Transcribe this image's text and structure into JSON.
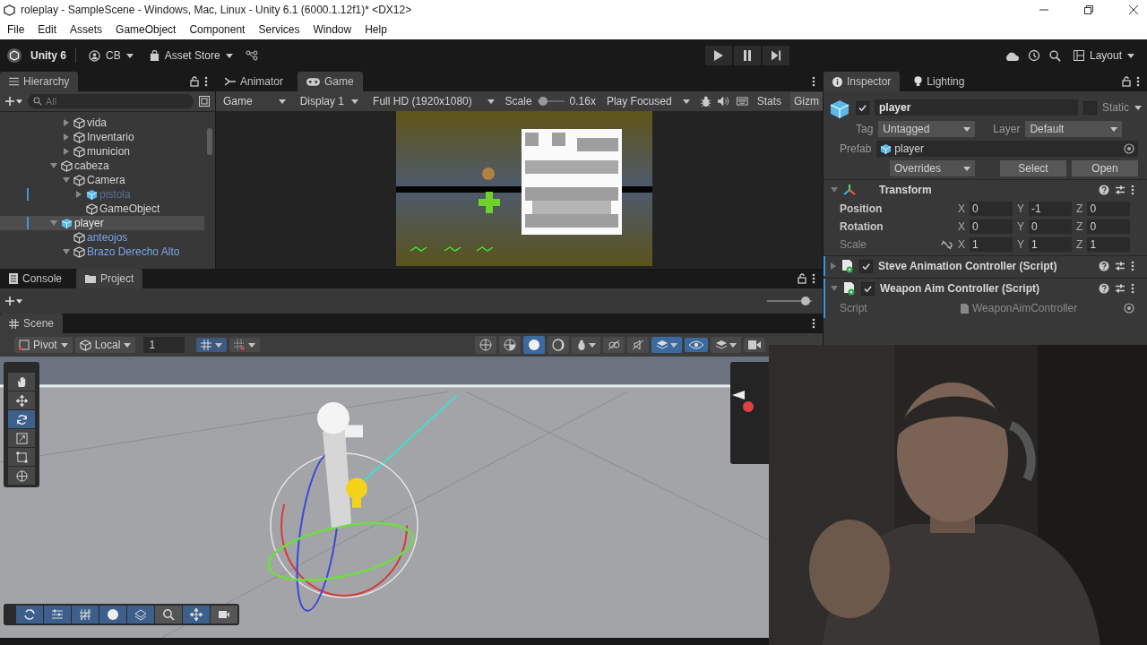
{
  "window": {
    "title": "roleplay - SampleScene - Windows, Mac, Linux - Unity 6.1 (6000.1.12f1)* <DX12>"
  },
  "menu": [
    "File",
    "Edit",
    "Assets",
    "GameObject",
    "Component",
    "Services",
    "Window",
    "Help"
  ],
  "toolbar": {
    "product": "Unity 6",
    "account": "CB",
    "store": "Asset Store",
    "layout": "Layout"
  },
  "hierarchy": {
    "title": "Hierarchy",
    "search_placeholder": "All",
    "items": [
      {
        "children": [
          {
            "name": "vida",
            "expanded": false,
            "selected": false,
            "disabled": false,
            "prefab": false,
            "prefab_root": false,
            "override": false
          },
          {
            "name": "Inventario",
            "expanded": false,
            "selected": false,
            "disabled": false,
            "prefab": false,
            "prefab_root": false,
            "override": false
          },
          {
            "name": "municion",
            "expanded": false,
            "selected": false,
            "disabled": false,
            "prefab": false,
            "prefab_root": false,
            "override": false
          }
        ]
      },
      {
        "name": "cabeza",
        "expanded": true,
        "selected": false,
        "disabled": false,
        "prefab": false,
        "prefab_root": false,
        "override": false,
        "children": [
          {
            "name": "Camera",
            "expanded": true,
            "selected": false,
            "disabled": false,
            "prefab": false,
            "prefab_root": false,
            "override": false,
            "children": [
              {
                "name": "pistola",
                "expanded": false,
                "selected": false,
                "disabled": true,
                "prefab": true,
                "prefab_root": true,
                "override": true
              },
              {
                "name": "GameObject",
                "selected": false,
                "disabled": false,
                "prefab": false,
                "prefab_root": false,
                "override": false
              }
            ]
          }
        ]
      },
      {
        "name": "player",
        "expanded": true,
        "selected": true,
        "disabled": false,
        "prefab": false,
        "prefab_root": true,
        "override": true,
        "children": [
          {
            "name": "anteojos",
            "selected": false,
            "disabled": false,
            "prefab": true,
            "prefab_root": false,
            "override": false
          },
          {
            "name": "Brazo Derecho Alto",
            "expanded": true,
            "selected": false,
            "disabled": false,
            "prefab": true,
            "prefab_root": false,
            "override": false
          }
        ]
      }
    ]
  },
  "game": {
    "tabs": [
      {
        "label": "Animator",
        "selected": false
      },
      {
        "label": "Game",
        "selected": true
      }
    ],
    "view": "Game",
    "display": "Display 1",
    "resolution": "Full HD (1920x1080)",
    "scale_label": "Scale",
    "scale_slider": {
      "level": 0.05
    },
    "scale": "0.16x",
    "play_mode": "Play Focused",
    "stats": "Stats",
    "gizmos": "Gizm"
  },
  "inspector": {
    "tabs": [
      {
        "label": "Inspector",
        "selected": true
      },
      {
        "label": "Lighting",
        "selected": false
      }
    ],
    "object": {
      "name": "player",
      "active": true,
      "static": false,
      "static_label": "Static",
      "tag_label": "Tag",
      "tag": "Untagged",
      "layer_label": "Layer",
      "layer": "Default",
      "prefab_label": "Prefab",
      "prefab": "player",
      "overrides": "Overrides",
      "select": "Select",
      "open": "Open"
    },
    "components": [
      {
        "kind": "transform",
        "name": "Transform",
        "expanded": true,
        "rows": [
          {
            "kind": "vector",
            "label": "Position",
            "values": [
              {
                "axis": "X",
                "value": "0"
              },
              {
                "axis": "Y",
                "value": "-1"
              },
              {
                "axis": "Z",
                "value": "0"
              }
            ]
          },
          {
            "kind": "vector",
            "label": "Rotation",
            "values": [
              {
                "axis": "X",
                "value": "0"
              },
              {
                "axis": "Y",
                "value": "0"
              },
              {
                "axis": "Z",
                "value": "0"
              }
            ]
          },
          {
            "kind": "scale",
            "label": "Scale",
            "values": [
              {
                "axis": "X",
                "value": "1"
              },
              {
                "axis": "Y",
                "value": "1"
              },
              {
                "axis": "Z",
                "value": "1"
              }
            ]
          }
        ]
      },
      {
        "kind": "script",
        "name": "Steve Animation Controller (Script)",
        "enabled": true,
        "expanded": false
      },
      {
        "kind": "script",
        "name": "Weapon Aim Controller (Script)",
        "enabled": true,
        "expanded": true,
        "fields": [
          {
            "label": "Script",
            "value": "WeaponAimController"
          }
        ]
      }
    ]
  },
  "bottom_panel": {
    "tabs": [
      {
        "label": "Console",
        "selected": false
      },
      {
        "label": "Project",
        "selected": true
      }
    ],
    "zoom_slider": {
      "level": 0.95
    }
  },
  "scene": {
    "tab": "Scene",
    "pivot": "Pivot",
    "space": "Local",
    "grid_value": "1",
    "shading": [
      {
        "selected": false
      },
      {
        "selected": false
      },
      {
        "selected": true
      },
      {
        "selected": false
      }
    ],
    "tools": [
      {
        "selected": false
      },
      {
        "selected": false
      },
      {
        "selected": true
      },
      {
        "selected": false
      },
      {
        "selected": false
      },
      {
        "selected": false
      }
    ],
    "overlay_tools": [
      {
        "selected": true
      },
      {
        "selected": true
      },
      {
        "selected": true
      },
      {
        "selected": true
      },
      {
        "selected": true
      },
      {
        "selected": false
      },
      {
        "selected": true
      },
      {
        "selected": false
      }
    ]
  }
}
